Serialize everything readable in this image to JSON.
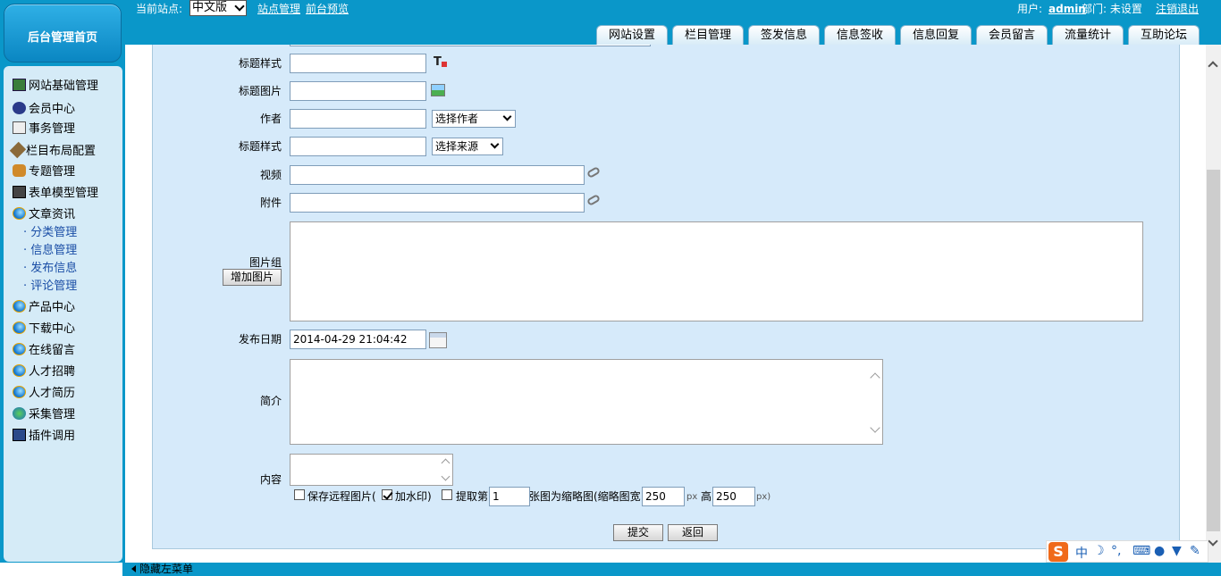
{
  "header": {
    "home_label": "后台管理首页",
    "current_site_label": "当前站点:",
    "site_select": "中文版",
    "site_manage": "站点管理",
    "front_preview": "前台预览",
    "user_label": "用户:",
    "user_name": "admin",
    "dept_label": "部门: 未设置",
    "logout": "注销退出"
  },
  "tabs": [
    "网站设置",
    "栏目管理",
    "签发信息",
    "信息签收",
    "信息回复",
    "会员留言",
    "流量统计",
    "互助论坛"
  ],
  "sidebar": {
    "items": [
      {
        "label": "网站基础管理",
        "icon": "computer-icon"
      },
      {
        "label": "会员中心",
        "icon": "users-icon"
      },
      {
        "label": "事务管理",
        "icon": "notepad-icon"
      },
      {
        "label": "栏目布局配置",
        "icon": "tools-icon"
      },
      {
        "label": "专题管理",
        "icon": "group-icon"
      },
      {
        "label": "表单模型管理",
        "icon": "book-icon"
      },
      {
        "label": "文章资讯",
        "icon": "ie-icon"
      }
    ],
    "subitems": [
      "· 分类管理",
      "· 信息管理",
      "· 发布信息",
      "· 评论管理"
    ],
    "items2": [
      {
        "label": "产品中心",
        "icon": "ie-icon"
      },
      {
        "label": "下载中心",
        "icon": "ie-icon"
      },
      {
        "label": "在线留言",
        "icon": "ie-icon"
      },
      {
        "label": "人才招聘",
        "icon": "ie-icon"
      },
      {
        "label": "人才简历",
        "icon": "ie-icon"
      },
      {
        "label": "采集管理",
        "icon": "globe-icon"
      },
      {
        "label": "插件调用",
        "icon": "monitor-icon"
      }
    ]
  },
  "form": {
    "title_style_label": "标题样式",
    "title_image_label": "标题图片",
    "author_label": "作者",
    "author_select": "选择作者",
    "source_label": "标题样式",
    "source_select": "选择来源",
    "video_label": "视频",
    "attachment_label": "附件",
    "gallery_label": "图片组",
    "add_image_button": "增加图片",
    "publish_date_label": "发布日期",
    "publish_date_value": "2014-04-29 21:04:42",
    "summary_label": "简介",
    "content_label": "内容",
    "save_remote_label": "保存远程图片(",
    "watermark_label": "加水印)",
    "extract_label": "提取第",
    "extract_value": "1",
    "thumb_label": "张图为缩略图(缩略图宽",
    "thumb_width": "250",
    "px1": "px",
    "height_label": "高",
    "thumb_height": "250",
    "px2": "px)",
    "submit_button": "提交",
    "back_button": "返回"
  },
  "footer": {
    "hide_menu": "隐藏左菜单"
  },
  "ime": {
    "logo": "S",
    "mode": "中"
  }
}
